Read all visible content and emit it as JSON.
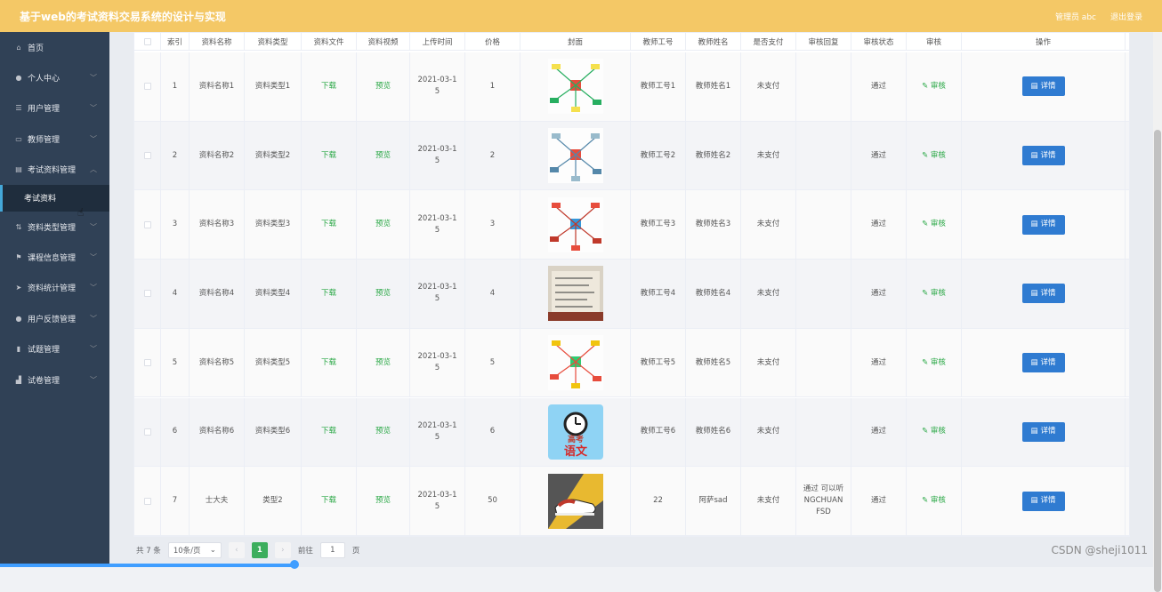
{
  "header": {
    "title": "基于web的考试资料交易系统的设计与实现",
    "admin": "管理员 abc",
    "logout": "退出登录"
  },
  "sidebar": {
    "items": [
      {
        "label": "首页",
        "icon": "home-icon"
      },
      {
        "label": "个人中心",
        "icon": "user-icon",
        "chevron": "﹀"
      },
      {
        "label": "用户管理",
        "icon": "list-icon",
        "chevron": "﹀"
      },
      {
        "label": "教师管理",
        "icon": "card-icon",
        "chevron": "﹀"
      },
      {
        "label": "考试资料管理",
        "icon": "doc-icon",
        "chevron": "︿"
      },
      {
        "label": "资料类型管理",
        "icon": "sort-icon",
        "chevron": "﹀"
      },
      {
        "label": "课程信息管理",
        "icon": "flag-icon",
        "chevron": "﹀"
      },
      {
        "label": "资料统计管理",
        "icon": "send-icon",
        "chevron": "﹀"
      },
      {
        "label": "用户反馈管理",
        "icon": "user-icon",
        "chevron": "﹀"
      },
      {
        "label": "试题管理",
        "icon": "bar-icon",
        "chevron": "﹀"
      },
      {
        "label": "试卷管理",
        "icon": "chart-icon",
        "chevron": "﹀"
      }
    ],
    "sub_item": "考试资料"
  },
  "table": {
    "headers": [
      "",
      "索引",
      "资料名称",
      "资料类型",
      "资料文件",
      "资料视频",
      "上传时间",
      "价格",
      "封面",
      "教师工号",
      "教师姓名",
      "是否支付",
      "审核回复",
      "审核状态",
      "审核",
      "操作"
    ],
    "rows": [
      {
        "idx": "1",
        "name": "资料名称1",
        "type": "资料类型1",
        "file": "下载",
        "video": "预览",
        "time": "2021-03-1\n5",
        "price": "1",
        "cover": "mindmap-a",
        "tno": "教师工号1",
        "tname": "教师姓名1",
        "paid": "未支付",
        "reply": "",
        "status": "通过",
        "audit": "审核",
        "op": "详情"
      },
      {
        "idx": "2",
        "name": "资料名称2",
        "type": "资料类型2",
        "file": "下载",
        "video": "预览",
        "time": "2021-03-1\n5",
        "price": "2",
        "cover": "mindmap-b",
        "tno": "教师工号2",
        "tname": "教师姓名2",
        "paid": "未支付",
        "reply": "",
        "status": "通过",
        "audit": "审核",
        "op": "详情"
      },
      {
        "idx": "3",
        "name": "资料名称3",
        "type": "资料类型3",
        "file": "下载",
        "video": "预览",
        "time": "2021-03-1\n5",
        "price": "3",
        "cover": "mindmap-c",
        "tno": "教师工号3",
        "tname": "教师姓名3",
        "paid": "未支付",
        "reply": "",
        "status": "通过",
        "audit": "审核",
        "op": "详情"
      },
      {
        "idx": "4",
        "name": "资料名称4",
        "type": "资料类型4",
        "file": "下载",
        "video": "预览",
        "time": "2021-03-1\n5",
        "price": "4",
        "cover": "notes-photo",
        "tno": "教师工号4",
        "tname": "教师姓名4",
        "paid": "未支付",
        "reply": "",
        "status": "通过",
        "audit": "审核",
        "op": "详情"
      },
      {
        "idx": "5",
        "name": "资料名称5",
        "type": "资料类型5",
        "file": "下载",
        "video": "预览",
        "time": "2021-03-1\n5",
        "price": "5",
        "cover": "mindmap-d",
        "tno": "教师工号5",
        "tname": "教师姓名5",
        "paid": "未支付",
        "reply": "",
        "status": "通过",
        "audit": "审核",
        "op": "详情"
      },
      {
        "idx": "6",
        "name": "资料名称6",
        "type": "资料类型6",
        "file": "下载",
        "video": "预览",
        "time": "2021-03-1\n5",
        "price": "6",
        "cover": "gaokao-chinese",
        "cover_text_top": "高考",
        "cover_text_bottom": "语文",
        "tno": "教师工号6",
        "tname": "教师姓名6",
        "paid": "未支付",
        "reply": "",
        "status": "通过",
        "audit": "审核",
        "op": "详情"
      },
      {
        "idx": "7",
        "name": "士大夫",
        "type": "类型2",
        "file": "下载",
        "video": "预览",
        "time": "2021-03-1\n5",
        "price": "50",
        "cover": "sneaker-photo",
        "tno": "22",
        "tname": "阿萨sad",
        "paid": "未支付",
        "reply": "通过 可以听\nNGCHUAN\nFSD",
        "status": "通过",
        "audit": "审核",
        "op": "详情"
      }
    ]
  },
  "pagination": {
    "total": "共 7 条",
    "page_size": "10条/页",
    "current": "1",
    "goto_label": "前往",
    "goto_value": "1",
    "page_suffix": "页"
  },
  "watermark": "CSDN @sheji1011",
  "colors": {
    "topbar": "#f4c866",
    "sidebar": "#304156",
    "submenu_active": "#1f2d3d",
    "detail_button": "#2f7bd1",
    "link_green": "#28a744"
  }
}
